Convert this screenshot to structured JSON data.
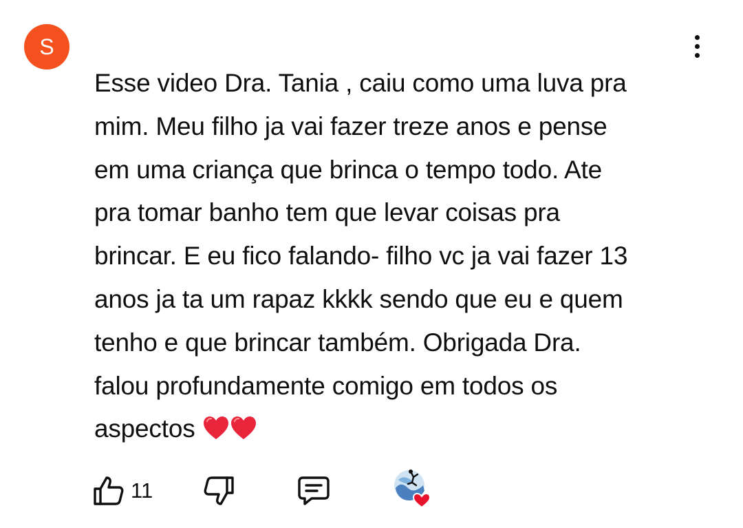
{
  "comment": {
    "author_initial": "S",
    "avatar_color": "#f4511e",
    "text_lines": [
      "Esse video Dra. Tania , caiu como uma luva pra",
      "mim. Meu filho ja vai fazer treze anos e pense",
      "em uma criança que brinca o tempo todo. Ate",
      "pra tomar banho tem que levar coisas pra",
      "brincar. E eu fico falando- filho vc ja vai fazer 13",
      "anos ja ta um rapaz kkkk sendo que eu e quem",
      "tenho e que brincar também. Obrigada Dra.",
      "falou profundamente comigo em todos os",
      "aspectos"
    ],
    "emoji": [
      "red-heart",
      "red-heart"
    ]
  },
  "actions": {
    "like_icon": "thumbs-up-icon",
    "like_count": "11",
    "dislike_icon": "thumbs-down-icon",
    "reply_icon": "reply-comment-icon",
    "creator_heart_icon": "creator-heart-icon",
    "heart_color": "#e8122c"
  },
  "menu": {
    "icon": "more-vertical-icon"
  }
}
